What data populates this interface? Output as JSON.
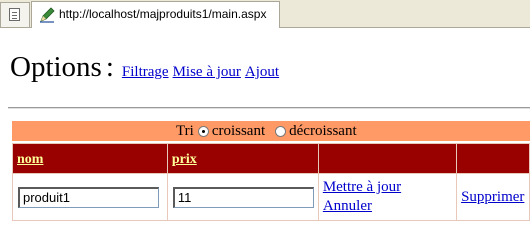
{
  "browser": {
    "tab_url": "http://localhost/majproduits1/main.aspx"
  },
  "header": {
    "title": "Options",
    "separator": ":",
    "links": [
      "Filtrage",
      "Mise à jour",
      "Ajout"
    ]
  },
  "sort": {
    "label": "Tri",
    "option_asc": "croissant",
    "option_desc": "décroissant",
    "selected": "croissant"
  },
  "table": {
    "columns": [
      "nom",
      "prix"
    ],
    "rows": [
      {
        "nom": "produit1",
        "prix": "11",
        "update_label": "Mettre à jour",
        "cancel_label": "Annuler",
        "delete_label": "Supprimer"
      }
    ]
  },
  "colors": {
    "sort_bar": "#ff9966",
    "table_header": "#990000",
    "header_link": "#ffff99",
    "link": "#0000cc"
  }
}
